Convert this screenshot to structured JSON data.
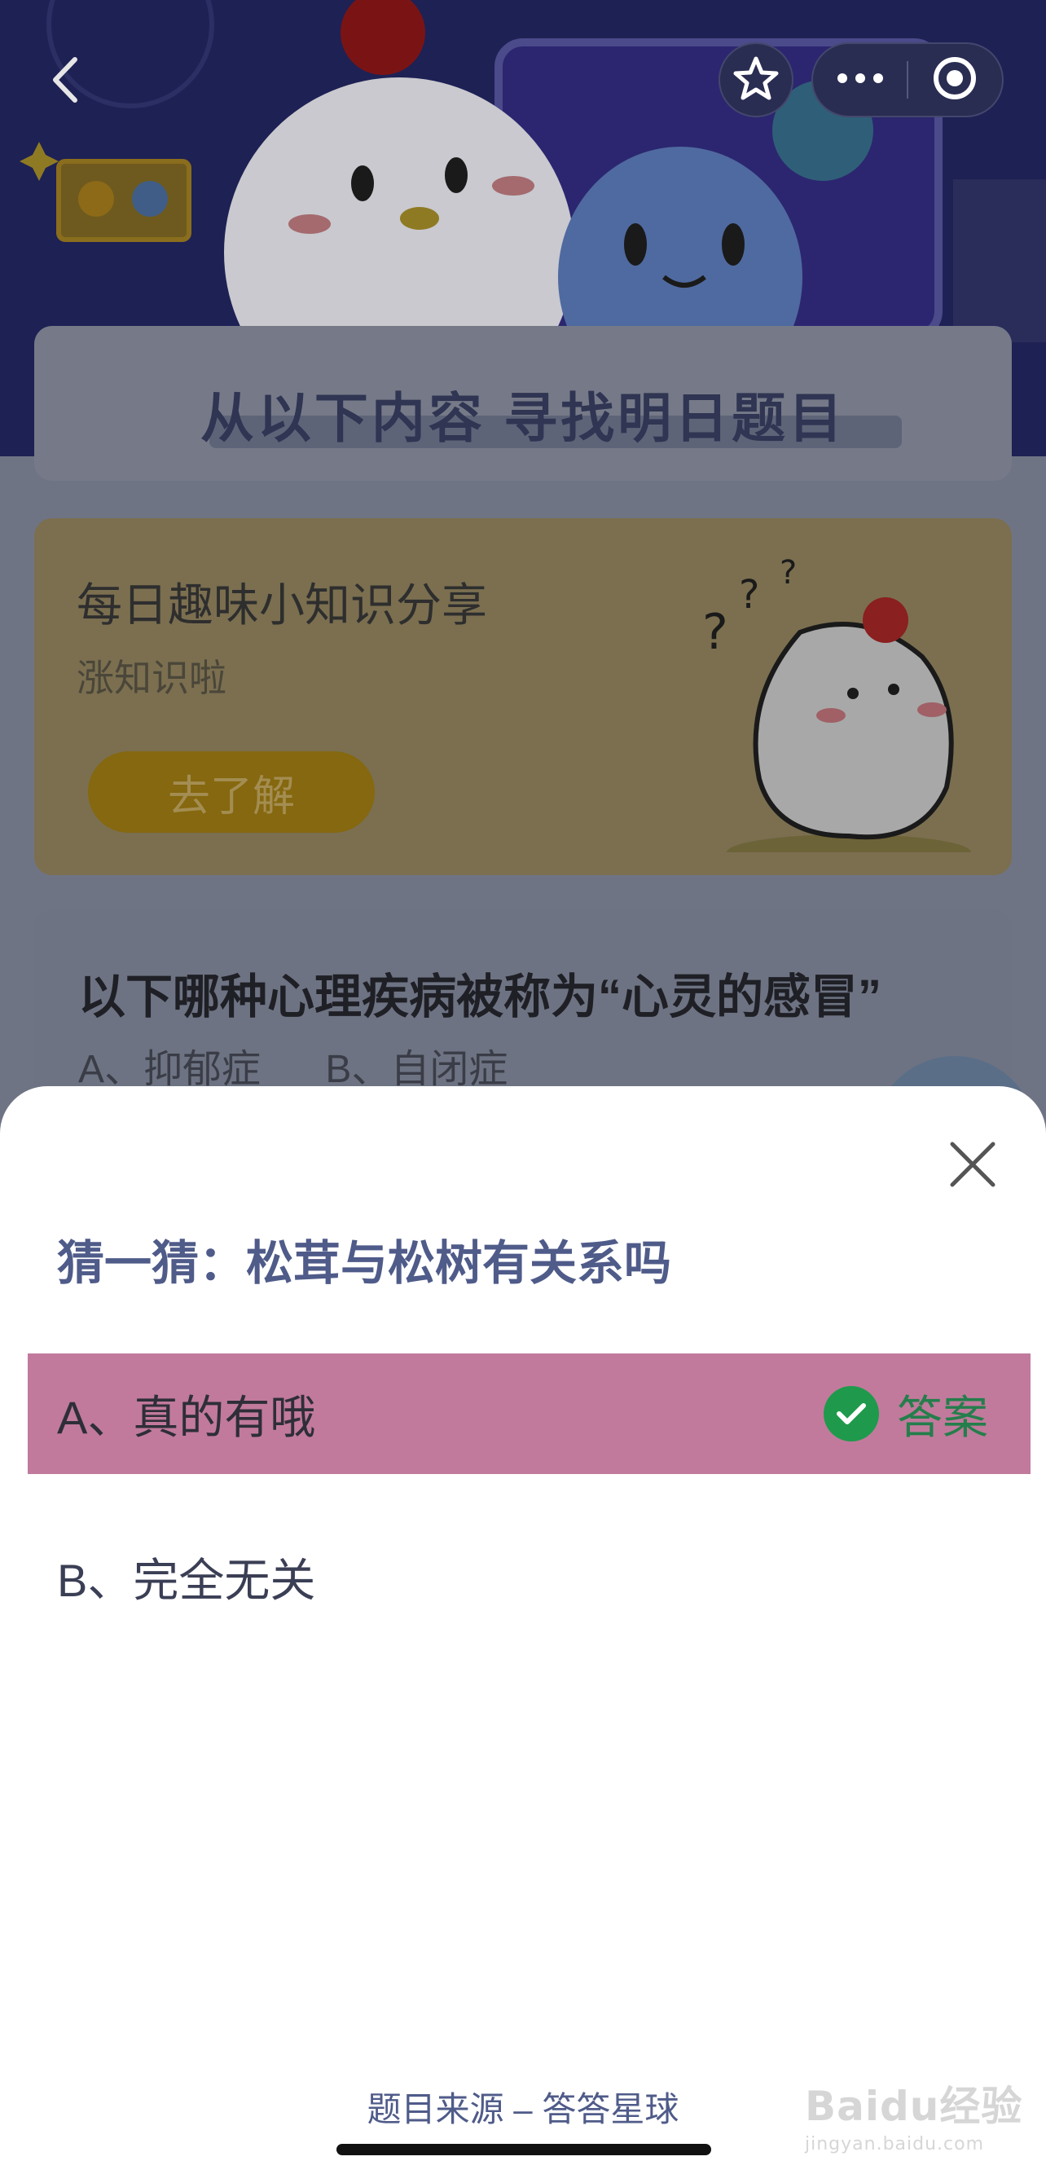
{
  "background_page": {
    "section_header_title": "从以下内容 寻找明日题目",
    "promo_card": {
      "title": "每日趣味小知识分享",
      "subtitle": "涨知识啦",
      "button_label": "去了解"
    },
    "quiz_card": {
      "question": "以下哪种心理疾病被称为“心灵的感冒”",
      "options": [
        "A、抑郁症",
        "B、自闭症"
      ]
    },
    "nav_icons": [
      "back-icon",
      "star-icon",
      "more-icon",
      "record-icon"
    ]
  },
  "sheet": {
    "title": "猜一猜：松茸与松树有关系吗",
    "options": [
      {
        "label": "A、真的有哦",
        "is_answer": true
      },
      {
        "label": "B、完全无关",
        "is_answer": false
      }
    ],
    "answer_tag": "答案",
    "source": "题目来源 – 答答星球",
    "watermark_main": "Baidu经验",
    "watermark_sub": "jingyan.baidu.com"
  },
  "colors": {
    "sheet_title": "#4f5b89",
    "correct_option_bg": "#c17a9c",
    "answer_green": "#1f9a4c"
  }
}
